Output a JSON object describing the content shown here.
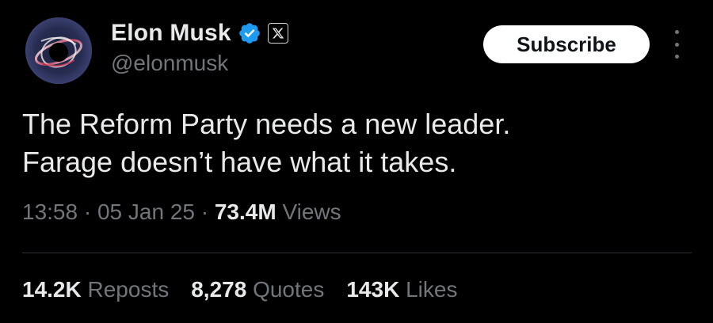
{
  "author": {
    "display_name": "Elon Musk",
    "handle": "@elonmusk",
    "verified": true,
    "affiliate_badge": "x-logo-icon",
    "avatar": "black-hole-avatar"
  },
  "actions": {
    "subscribe_label": "Subscribe",
    "more_icon": "more-vertical-icon"
  },
  "tweet": {
    "lines": [
      "The Reform Party needs a new leader.",
      "Farage doesn’t have what it takes."
    ],
    "time": "13:58",
    "date": "05 Jan 25",
    "separator": "·",
    "views_count": "73.4M",
    "views_label": "Views"
  },
  "stats": {
    "reposts_count": "14.2K",
    "reposts_label": "Reposts",
    "quotes_count": "8,278",
    "quotes_label": "Quotes",
    "likes_count": "143K",
    "likes_label": "Likes"
  },
  "colors": {
    "background": "#000000",
    "primary_text": "#e7e9ea",
    "secondary_text": "#71767b",
    "verified_blue": "#1d9bf0",
    "divider": "#2f3336",
    "button_bg": "#ffffff"
  }
}
